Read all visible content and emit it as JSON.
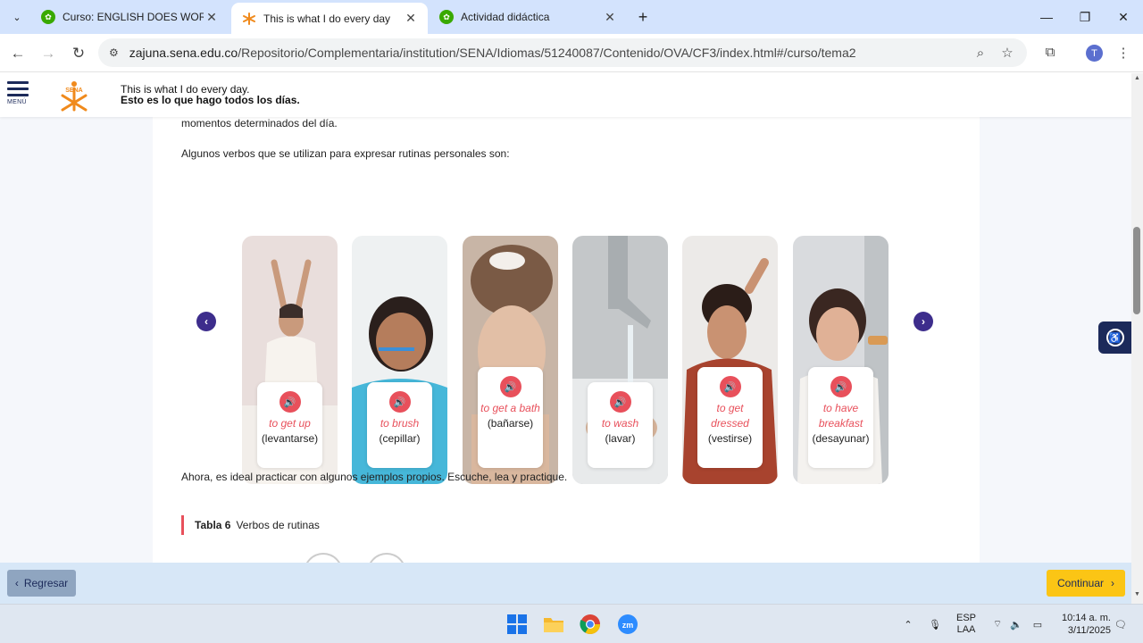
{
  "browser": {
    "tabs": [
      {
        "title": "Curso: ENGLISH DOES WORK -",
        "active": false
      },
      {
        "title": "This is what I do every day",
        "active": true
      },
      {
        "title": "Actividad didáctica",
        "active": false
      }
    ],
    "url_host": "zajuna.sena.edu.co",
    "url_path": "/Repositorio/Complementaria/institution/SENA/Idiomas/51240087/Contenido/OVA/CF3/index.html#/curso/tema2",
    "profile_initial": "T"
  },
  "header": {
    "menu_label": "MENÚ",
    "logo_text": "SENA",
    "title": "This is what I do every day.",
    "subtitle": "Esto es lo que hago todos los días."
  },
  "content": {
    "para_top": "momentos determinados del día.",
    "para_intro": "Algunos verbos que se utilizan para expresar rutinas personales son:",
    "para_practice": "Ahora, es ideal practicar con algunos ejemplos propios. Escuche, lea y practique.",
    "table_label": "Tabla 6",
    "table_title": "Verbos de rutinas",
    "cards": [
      {
        "en": "to get up",
        "es": "(levantarse)"
      },
      {
        "en": "to brush",
        "es": "(cepillar)"
      },
      {
        "en": "to get a bath",
        "es": "(bañarse)"
      },
      {
        "en": "to wash",
        "es": "(lavar)"
      },
      {
        "en": "to get dressed",
        "es": "(vestirse)"
      },
      {
        "en": "to have breakfast",
        "es": "(desayunar)"
      }
    ]
  },
  "footer": {
    "back_label": "Regresar",
    "next_label": "Continuar"
  },
  "taskbar": {
    "lang_line1": "ESP",
    "lang_line2": "LAA",
    "time": "10:14 a. m.",
    "date": "3/11/2025"
  },
  "colors": {
    "accent_red": "#e8505b",
    "brand_navy": "#1c2a5a",
    "arrow_purple": "#3d2d8c",
    "continue_yellow": "#fbc515"
  }
}
